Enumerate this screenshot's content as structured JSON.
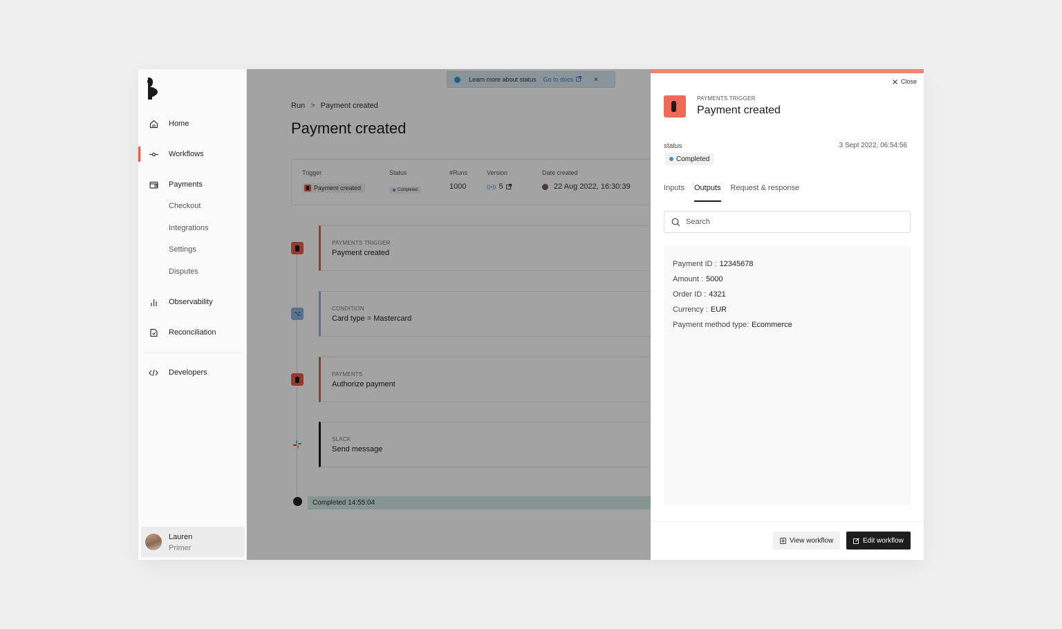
{
  "banner": {
    "text": "Learn more about status",
    "link": "Go to docs",
    "close": "×"
  },
  "sidebar": {
    "items": [
      {
        "label": "Home",
        "icon": "home-icon"
      },
      {
        "label": "Workflows",
        "icon": "workflow-icon",
        "active": true
      },
      {
        "label": "Payments",
        "icon": "payments-icon"
      },
      {
        "label": "Observability",
        "icon": "bar-chart-icon"
      },
      {
        "label": "Reconciliation",
        "icon": "reconciliation-icon"
      },
      {
        "label": "Developers",
        "icon": "code-icon"
      }
    ],
    "payments_sub": [
      "Checkout",
      "Integrations",
      "Settings",
      "Disputes"
    ],
    "user": {
      "name": "Lauren",
      "org": "Primer"
    }
  },
  "breadcrumb": {
    "root": "Run",
    "separator": ">",
    "current": "Payment created"
  },
  "page_title": "Payment created",
  "summary": {
    "trigger_label": "Trigger",
    "trigger_value": "Payment created",
    "status_label": "Status",
    "status_value": "Completed",
    "runs_label": "#Runs",
    "runs_value": "1000",
    "version_label": "Version",
    "version_value": "5",
    "date_label": "Date created",
    "date_value": "22 Aug 2022, 16:30:39"
  },
  "steps": [
    {
      "kicker": "PAYMENTS TRIGGER",
      "title": "Payment created"
    },
    {
      "kicker": "CONDITION",
      "title": "Card type = Mastercard"
    },
    {
      "kicker": "PAYMENTS",
      "title": "Authorize payment"
    },
    {
      "kicker": "SLACK",
      "title": "Send message"
    }
  ],
  "timeline_end": "Completed 14:55:04",
  "drawer": {
    "close": "Close",
    "kicker": "PAYMENTS TRIGGER",
    "title": "Payment created",
    "status_label": "status",
    "status_value": "Completed",
    "date": "3 Sept 2022, 06:54:56",
    "tabs": [
      "Inputs",
      "Outputs",
      "Request & response"
    ],
    "active_tab": "Outputs",
    "search_placeholder": "Search",
    "outputs": [
      {
        "key": "Payment ID :",
        "value": "12345678"
      },
      {
        "key": "Amount :",
        "value": "5000"
      },
      {
        "key": "Order ID :",
        "value": "4321"
      },
      {
        "key": "Currency :",
        "value": "EUR"
      },
      {
        "key": "Payment method type:",
        "value": "Ecommerce"
      }
    ],
    "view_workflow": "View workflow",
    "edit_workflow": "Edit workflow"
  },
  "colors": {
    "brand": "#e85c4a",
    "drawer_accent": "#f08474",
    "status_dot": "#3a8fc7",
    "end_bar": "#d0eae3"
  }
}
